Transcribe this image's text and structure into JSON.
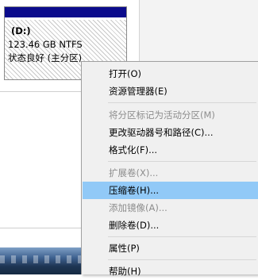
{
  "partition": {
    "drive": "(D:)",
    "size_fs": "123.46 GB NTFS",
    "status": "状态良好 (主分区)"
  },
  "menu": {
    "items": [
      {
        "label": "打开(O)",
        "disabled": false
      },
      {
        "label": "资源管理器(E)",
        "disabled": false
      },
      {
        "label": "将分区标记为活动分区(M)",
        "disabled": true
      },
      {
        "label": "更改驱动器号和路径(C)...",
        "disabled": false
      },
      {
        "label": "格式化(F)...",
        "disabled": false
      },
      {
        "label": "扩展卷(X)...",
        "disabled": true
      },
      {
        "label": "压缩卷(H)...",
        "disabled": false,
        "highlighted": true
      },
      {
        "label": "添加镜像(A)...",
        "disabled": true
      },
      {
        "label": "删除卷(D)...",
        "disabled": false
      },
      {
        "label": "属性(P)",
        "disabled": false
      },
      {
        "label": "帮助(H)",
        "disabled": false
      }
    ]
  },
  "colors": {
    "partition_header": "#0b0b8c",
    "highlight": "#91c9f7",
    "disabled_text": "#8d8d8d"
  }
}
